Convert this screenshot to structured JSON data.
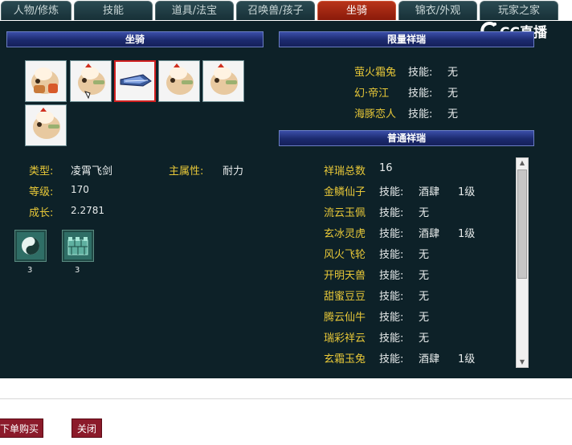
{
  "tabs": [
    {
      "label": "人物/修炼",
      "active": false
    },
    {
      "label": "技能",
      "active": false
    },
    {
      "label": "道具/法宝",
      "active": false
    },
    {
      "label": "召唤兽/孩子",
      "active": false
    },
    {
      "label": "坐骑",
      "active": true
    },
    {
      "label": "锦衣/外观",
      "active": false
    },
    {
      "label": "玩家之家",
      "active": false
    }
  ],
  "watermark": {
    "text": "CC直播",
    "icon": "cc-live-logo-icon"
  },
  "mounts_panel": {
    "title": "坐骑",
    "mounts": [
      {
        "icon": "beige-horse-mount-icon",
        "selected": false
      },
      {
        "icon": "beige-horse-mount-icon",
        "selected": false
      },
      {
        "icon": "flying-sword-mount-icon",
        "selected": true
      },
      {
        "icon": "beige-horse-mount-icon",
        "selected": false
      },
      {
        "icon": "beige-horse-mount-icon",
        "selected": false
      },
      {
        "icon": "beige-horse-mount-icon",
        "selected": false
      }
    ],
    "info": {
      "type_label": "类型:",
      "type_value": "凌霄飞剑",
      "main_attr_label": "主属性:",
      "main_attr_value": "耐力",
      "level_label": "等级:",
      "level_value": "170",
      "growth_label": "成长:",
      "growth_value": "2.2781"
    },
    "skills": [
      {
        "icon": "yin-yang-skill-icon",
        "level": "3"
      },
      {
        "icon": "city-wall-skill-icon",
        "level": "3"
      }
    ]
  },
  "limited_panel": {
    "title": "限量祥瑞",
    "rows": [
      {
        "name": "萤火霜兔",
        "skill_label": "技能:",
        "skill": "无"
      },
      {
        "name": "幻·帝江",
        "skill_label": "技能:",
        "skill": "无"
      },
      {
        "name": "海豚恋人",
        "skill_label": "技能:",
        "skill": "无"
      }
    ]
  },
  "normal_panel": {
    "title": "普通祥瑞",
    "total_label": "祥瑞总数",
    "total_value": "16",
    "rows": [
      {
        "name": "金鳞仙子",
        "skill_label": "技能:",
        "skill": "酒肆",
        "level": "1级"
      },
      {
        "name": "流云玉佩",
        "skill_label": "技能:",
        "skill": "无",
        "level": ""
      },
      {
        "name": "玄冰灵虎",
        "skill_label": "技能:",
        "skill": "酒肆",
        "level": "1级"
      },
      {
        "name": "风火飞轮",
        "skill_label": "技能:",
        "skill": "无",
        "level": ""
      },
      {
        "name": "开明天兽",
        "skill_label": "技能:",
        "skill": "无",
        "level": ""
      },
      {
        "name": "甜蜜豆豆",
        "skill_label": "技能:",
        "skill": "无",
        "level": ""
      },
      {
        "name": "腾云仙牛",
        "skill_label": "技能:",
        "skill": "无",
        "level": ""
      },
      {
        "name": "瑞彩祥云",
        "skill_label": "技能:",
        "skill": "无",
        "level": ""
      },
      {
        "name": "玄霜玉兔",
        "skill_label": "技能:",
        "skill": "酒肆",
        "level": "1级"
      }
    ]
  },
  "buttons": {
    "buy": "下单购买",
    "close": "关闭"
  }
}
